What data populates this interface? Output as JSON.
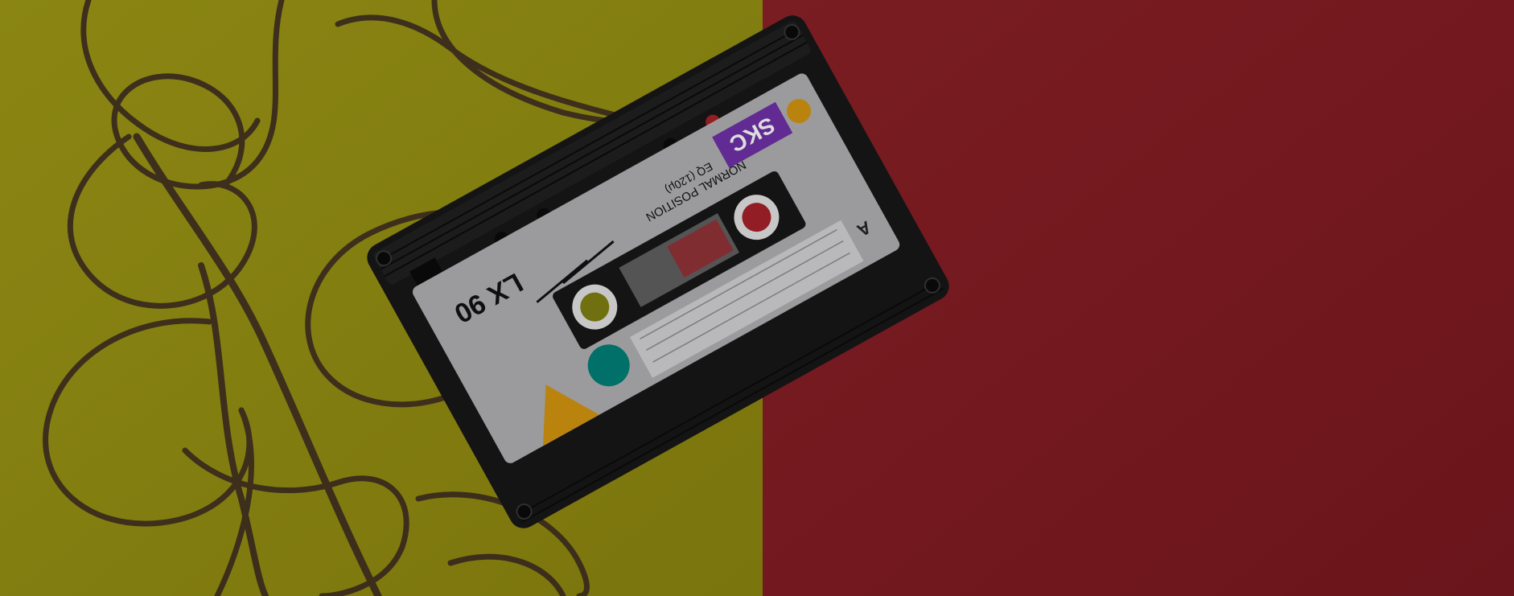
{
  "scene": {
    "background": {
      "left_color": "#8f8a12",
      "right_color": "#7e1b22"
    },
    "cassette": {
      "brand": "SKC",
      "model": "LX 90",
      "position_text": "NORMAL POSITION",
      "eq_text": "EQ (120μ)",
      "side": "A",
      "shell_color": "#161616",
      "label_color": "#a9a9ab",
      "brand_color": "#6a2fa0",
      "accent_orange": "#c98f10",
      "accent_teal": "#007a72"
    },
    "tape_color": "#3b2a20"
  }
}
